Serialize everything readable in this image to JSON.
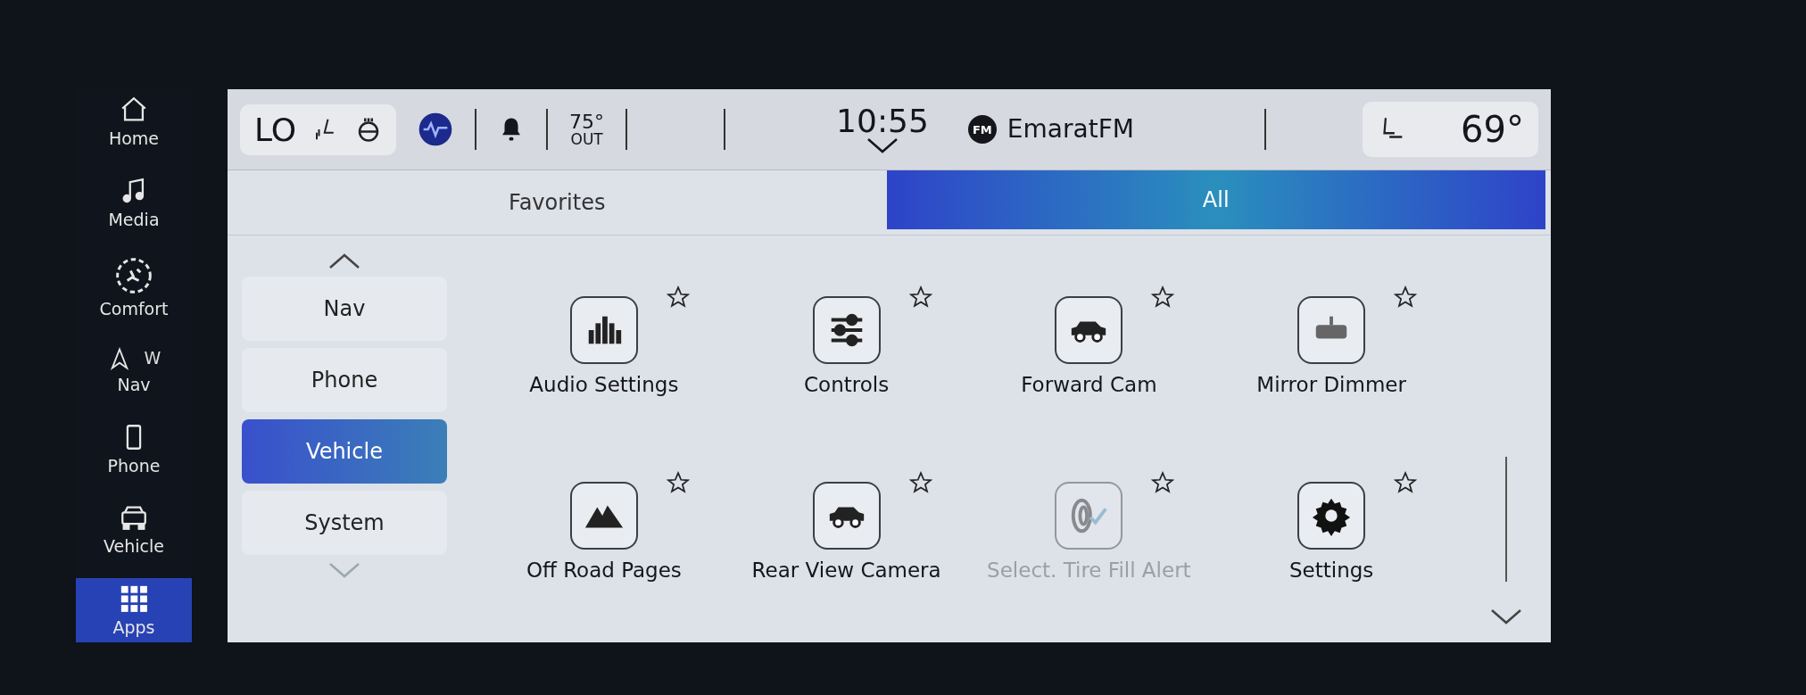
{
  "left_nav": [
    {
      "label": "Home",
      "kind": "home",
      "selected": false
    },
    {
      "label": "Media",
      "kind": "media",
      "selected": false
    },
    {
      "label": "Comfort",
      "kind": "comfort",
      "selected": false
    },
    {
      "label": "Nav",
      "kind": "nav",
      "heading": "W",
      "selected": false
    },
    {
      "label": "Phone",
      "kind": "phone",
      "selected": false
    },
    {
      "label": "Vehicle",
      "kind": "vehicle",
      "selected": false
    },
    {
      "label": "Apps",
      "kind": "apps",
      "selected": true
    }
  ],
  "status_bar": {
    "climate_left": "LO",
    "outside_temp": "75°",
    "outside_label": "OUT",
    "time": "10:55",
    "station_badge": "FM",
    "station": "EmaratFM",
    "climate_right": "69°"
  },
  "tabs": [
    {
      "label": "Favorites",
      "selected": false
    },
    {
      "label": "All",
      "selected": true
    }
  ],
  "categories": [
    {
      "label": "Nav",
      "selected": false
    },
    {
      "label": "Phone",
      "selected": false
    },
    {
      "label": "Vehicle",
      "selected": true
    },
    {
      "label": "System",
      "selected": false
    }
  ],
  "apps": [
    {
      "label": "Audio Settings",
      "kind": "audio",
      "disabled": false
    },
    {
      "label": "Controls",
      "kind": "controls",
      "disabled": false
    },
    {
      "label": "Forward Cam",
      "kind": "car",
      "disabled": false
    },
    {
      "label": "Mirror Dimmer",
      "kind": "mirror",
      "disabled": false
    },
    {
      "label": "Off Road Pages",
      "kind": "mountain",
      "disabled": false
    },
    {
      "label": "Rear View Camera",
      "kind": "car",
      "disabled": false
    },
    {
      "label": "Select. Tire Fill Alert",
      "kind": "tire",
      "disabled": true
    },
    {
      "label": "Settings",
      "kind": "gear",
      "disabled": false
    }
  ]
}
